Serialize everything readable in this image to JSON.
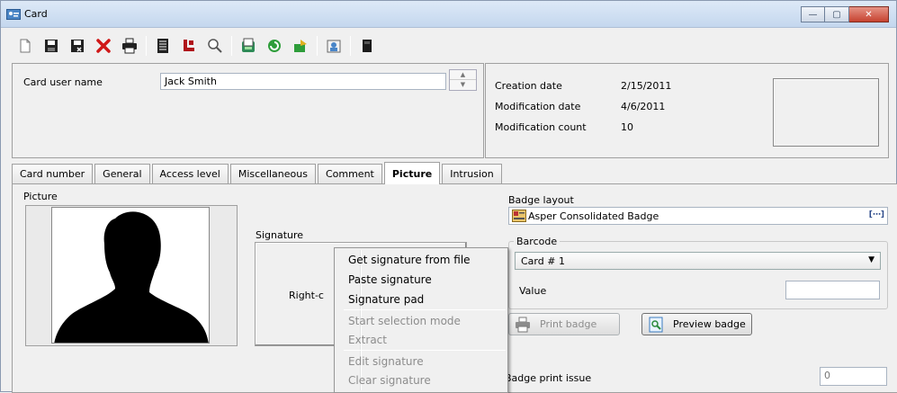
{
  "window": {
    "title": "Card",
    "minimize": "—",
    "maximize": "▢",
    "close": "✕"
  },
  "toolbar": [
    "new-icon",
    "save-icon",
    "save-as-icon",
    "delete-icon",
    "print-icon",
    "list-icon",
    "red-tool-icon",
    "search-icon",
    "copy-icon",
    "refresh-icon",
    "import-icon",
    "photo-icon",
    "dark-card-icon"
  ],
  "header": {
    "card_user_name_label": "Card user name",
    "card_user_name_value": "Jack Smith",
    "creation_date_label": "Creation date",
    "creation_date_value": "2/15/2011",
    "modification_date_label": "Modification date",
    "modification_date_value": "4/6/2011",
    "modification_count_label": "Modification count",
    "modification_count_value": "10"
  },
  "tabs": [
    {
      "label": "Card number"
    },
    {
      "label": "General"
    },
    {
      "label": "Access level"
    },
    {
      "label": "Miscellaneous"
    },
    {
      "label": "Comment"
    },
    {
      "label": "Picture",
      "active": true
    },
    {
      "label": "Intrusion"
    }
  ],
  "picture_tab": {
    "picture_label": "Picture",
    "signature_label": "Signature",
    "signature_hint": "Right-c",
    "badge_layout_label": "Badge layout",
    "badge_layout_value": "Asper Consolidated Badge",
    "barcode_label": "Barcode",
    "barcode_value": "Card # 1",
    "value_label": "Value",
    "value_field": "",
    "print_badge": "Print badge",
    "preview_badge": "Preview badge",
    "badge_print_issue_label": "Badge print issue",
    "badge_print_issue_value": "0"
  },
  "context_menu": {
    "get_from_file": "Get signature from file",
    "paste": "Paste signature",
    "pad": "Signature pad",
    "start_selection": "Start selection mode",
    "extract": "Extract",
    "edit": "Edit signature",
    "clear": "Clear signature"
  }
}
